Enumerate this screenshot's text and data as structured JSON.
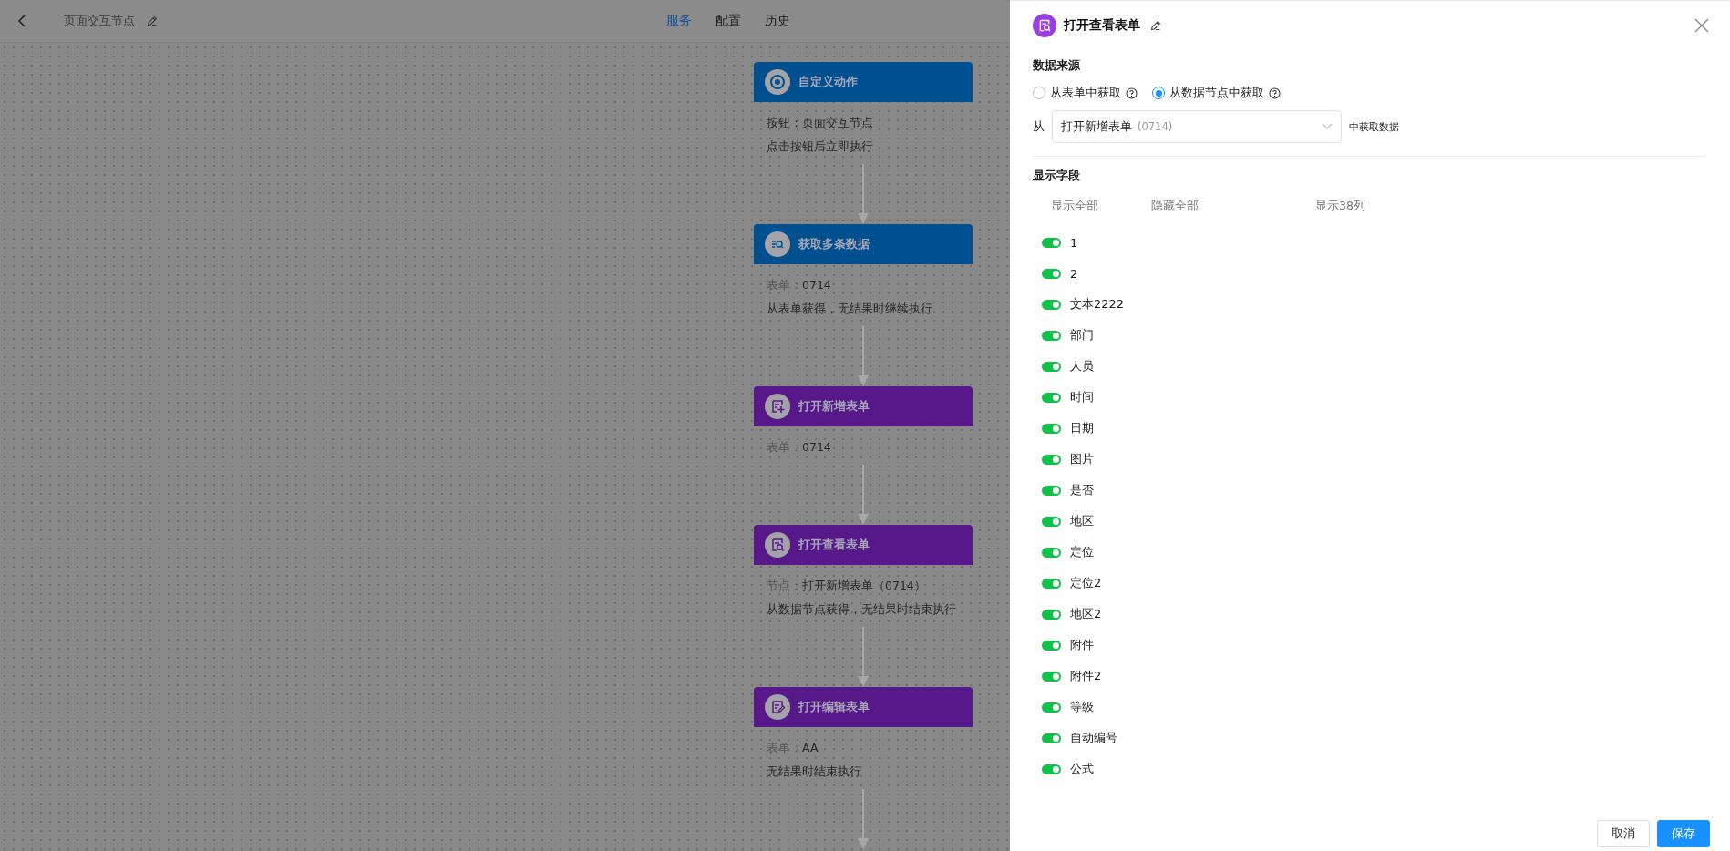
{
  "topbar": {
    "title": "页面交互节点",
    "tabs": [
      {
        "label": "服务",
        "selected": true
      },
      {
        "label": "配置",
        "selected": false
      },
      {
        "label": "历史",
        "selected": false
      }
    ]
  },
  "flow": {
    "nodes": [
      {
        "title": "自定义动作",
        "kind": "target",
        "color": "#004f8f",
        "lines": [
          {
            "text": "按钮：页面交互节点"
          },
          {
            "text": "点击按钮后立即执行"
          }
        ]
      },
      {
        "title": "获取多条数据",
        "kind": "search",
        "color": "#004f8f",
        "lines": [
          {
            "label": "表单：",
            "text": "0714"
          },
          {
            "text": "从表单获得，无结果时继续执行"
          }
        ]
      },
      {
        "title": "打开新增表单",
        "kind": "form-add",
        "color": "#57198a",
        "lines": [
          {
            "label": "表单：",
            "text": "0714"
          }
        ]
      },
      {
        "title": "打开查看表单",
        "kind": "form-view",
        "color": "#57198a",
        "lines": [
          {
            "label": "节点：",
            "text": "打开新增表单（0714）"
          },
          {
            "text": "从数据节点获得，无结果时结束执行"
          }
        ]
      },
      {
        "title": "打开编辑表单",
        "kind": "form-edit",
        "color": "#57198a",
        "lines": [
          {
            "label": "表单：",
            "text": "AA"
          },
          {
            "text": "无结果时结束执行"
          }
        ]
      }
    ]
  },
  "drawer": {
    "title": "打开查看表单",
    "data_source": {
      "heading": "数据来源",
      "options": [
        {
          "label": "从表单中获取",
          "selected": false
        },
        {
          "label": "从数据节点中获取",
          "selected": true
        }
      ],
      "prefix": "从",
      "select": {
        "value": "打开新增表单",
        "hint": "(0714)"
      },
      "suffix": "中获取数据"
    },
    "fields": {
      "heading": "显示字段",
      "actions": [
        "显示全部",
        "隐藏全部"
      ],
      "count": "显示38列",
      "items": [
        {
          "label": "1",
          "on": true
        },
        {
          "label": "2",
          "on": true
        },
        {
          "label": "文本2222",
          "on": true
        },
        {
          "label": "部门",
          "on": true
        },
        {
          "label": "人员",
          "on": true
        },
        {
          "label": "时间",
          "on": true
        },
        {
          "label": "日期",
          "on": true
        },
        {
          "label": "图片",
          "on": true
        },
        {
          "label": "是否",
          "on": true
        },
        {
          "label": "地区",
          "on": true
        },
        {
          "label": "定位",
          "on": true
        },
        {
          "label": "定位2",
          "on": true
        },
        {
          "label": "地区2",
          "on": true
        },
        {
          "label": "附件",
          "on": true
        },
        {
          "label": "附件2",
          "on": true
        },
        {
          "label": "等级",
          "on": true
        },
        {
          "label": "自动编号",
          "on": true
        },
        {
          "label": "公式",
          "on": true
        }
      ]
    },
    "buttons": [
      {
        "label": "取消",
        "kind": "default"
      },
      {
        "label": "保存",
        "kind": "primary"
      }
    ]
  }
}
